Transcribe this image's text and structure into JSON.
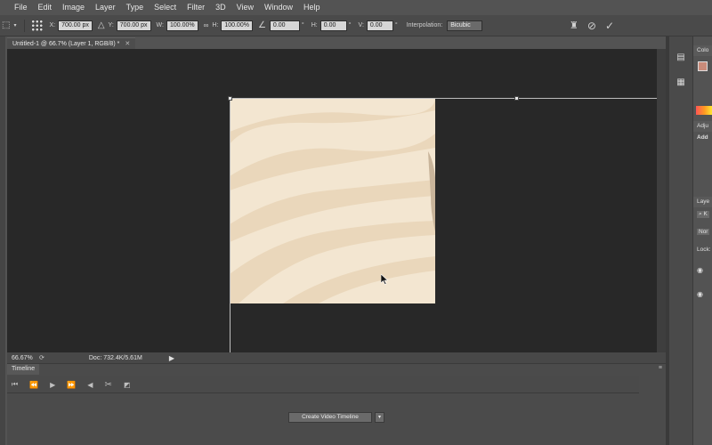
{
  "menu": [
    "File",
    "Edit",
    "Image",
    "Layer",
    "Type",
    "Select",
    "Filter",
    "3D",
    "View",
    "Window",
    "Help"
  ],
  "options": {
    "x_label": "X:",
    "x_value": "700.00 px",
    "y_label": "Y:",
    "y_value": "700.00 px",
    "w_label": "W:",
    "w_value": "100.00%",
    "h_label": "H:",
    "h_value": "100.00%",
    "angle_value": "0.00",
    "angle_unit": "°",
    "hskew_label": "H:",
    "hskew_value": "0.00",
    "hskew_unit": "°",
    "vskew_label": "V:",
    "vskew_value": "0.00",
    "vskew_unit": "°",
    "interp_label": "Interpolation:",
    "interp_value": "Bicubic"
  },
  "document": {
    "tab_title": "Untitled-1 @ 66.7% (Layer 1, RGB/8) *",
    "zoom": "66.67%",
    "doc_size": "Doc: 732.4K/5.61M"
  },
  "timeline": {
    "tab_label": "Timeline",
    "create_button": "Create Video Timeline"
  },
  "right_panel": {
    "color_header": "Colo",
    "adjust_header": "Adju",
    "adjust_add": "Add",
    "layers_header": "Laye",
    "blend": "Nor",
    "lock": "Lock:",
    "search_glyph": "⌕ K"
  },
  "colors": {
    "canvas_bg": "#282828",
    "image_bg": "#f3e6d1",
    "stripe": "#ead6b8",
    "foreground_swatch": "#c98b7a"
  }
}
